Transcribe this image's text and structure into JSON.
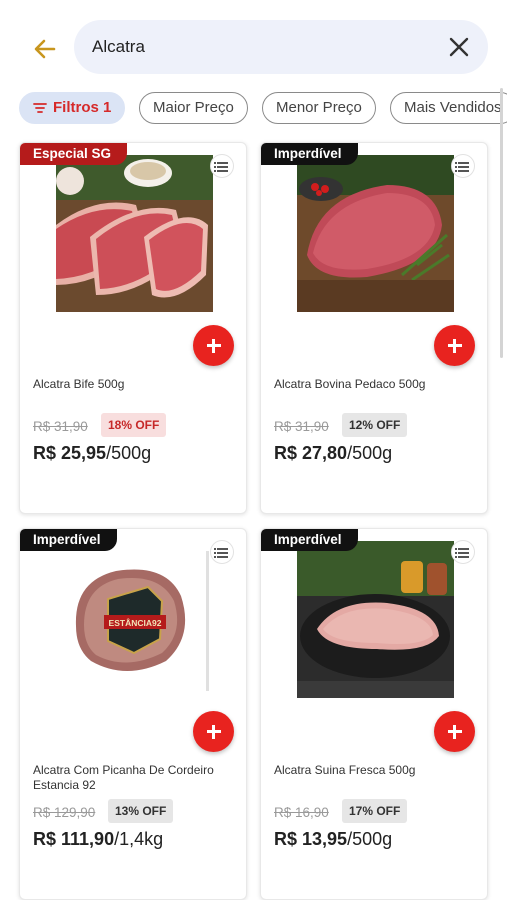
{
  "search": {
    "query": "Alcatra"
  },
  "filters": [
    {
      "label": "Filtros 1",
      "active": true
    },
    {
      "label": "Maior Preço",
      "active": false
    },
    {
      "label": "Menor Preço",
      "active": false
    },
    {
      "label": "Mais Vendidos",
      "active": false
    }
  ],
  "products": [
    {
      "badge": "Especial SG",
      "name": "Alcatra Bife 500g",
      "old_price": "R$ 31,90",
      "discount": "18% OFF",
      "price": "R$ 25,95",
      "unit": "/500g"
    },
    {
      "badge": "Imperdível",
      "name": "Alcatra Bovina Pedaco 500g",
      "old_price": "R$ 31,90",
      "discount": "12% OFF",
      "price": "R$ 27,80",
      "unit": "/500g"
    },
    {
      "badge": "Imperdível",
      "name": "Alcatra Com Picanha De Cordeiro Estancia 92",
      "old_price": "R$ 129,90",
      "discount": "13% OFF",
      "price": "R$ 111,90",
      "unit": "/1,4kg",
      "label_text": "ESTÂNCIA92"
    },
    {
      "badge": "Imperdível",
      "name": "Alcatra Suina Fresca 500g",
      "old_price": "R$ 16,90",
      "discount": "17% OFF",
      "price": "R$ 13,95",
      "unit": "/500g"
    }
  ],
  "colors": {
    "accent_red": "#e8231f",
    "badge_red": "#b51b1b",
    "back_arrow": "#c8961e",
    "search_bg": "#eef1fa"
  },
  "icons": [
    "back-arrow-icon",
    "close-icon",
    "filter-icon",
    "list-icon",
    "plus-icon"
  ]
}
